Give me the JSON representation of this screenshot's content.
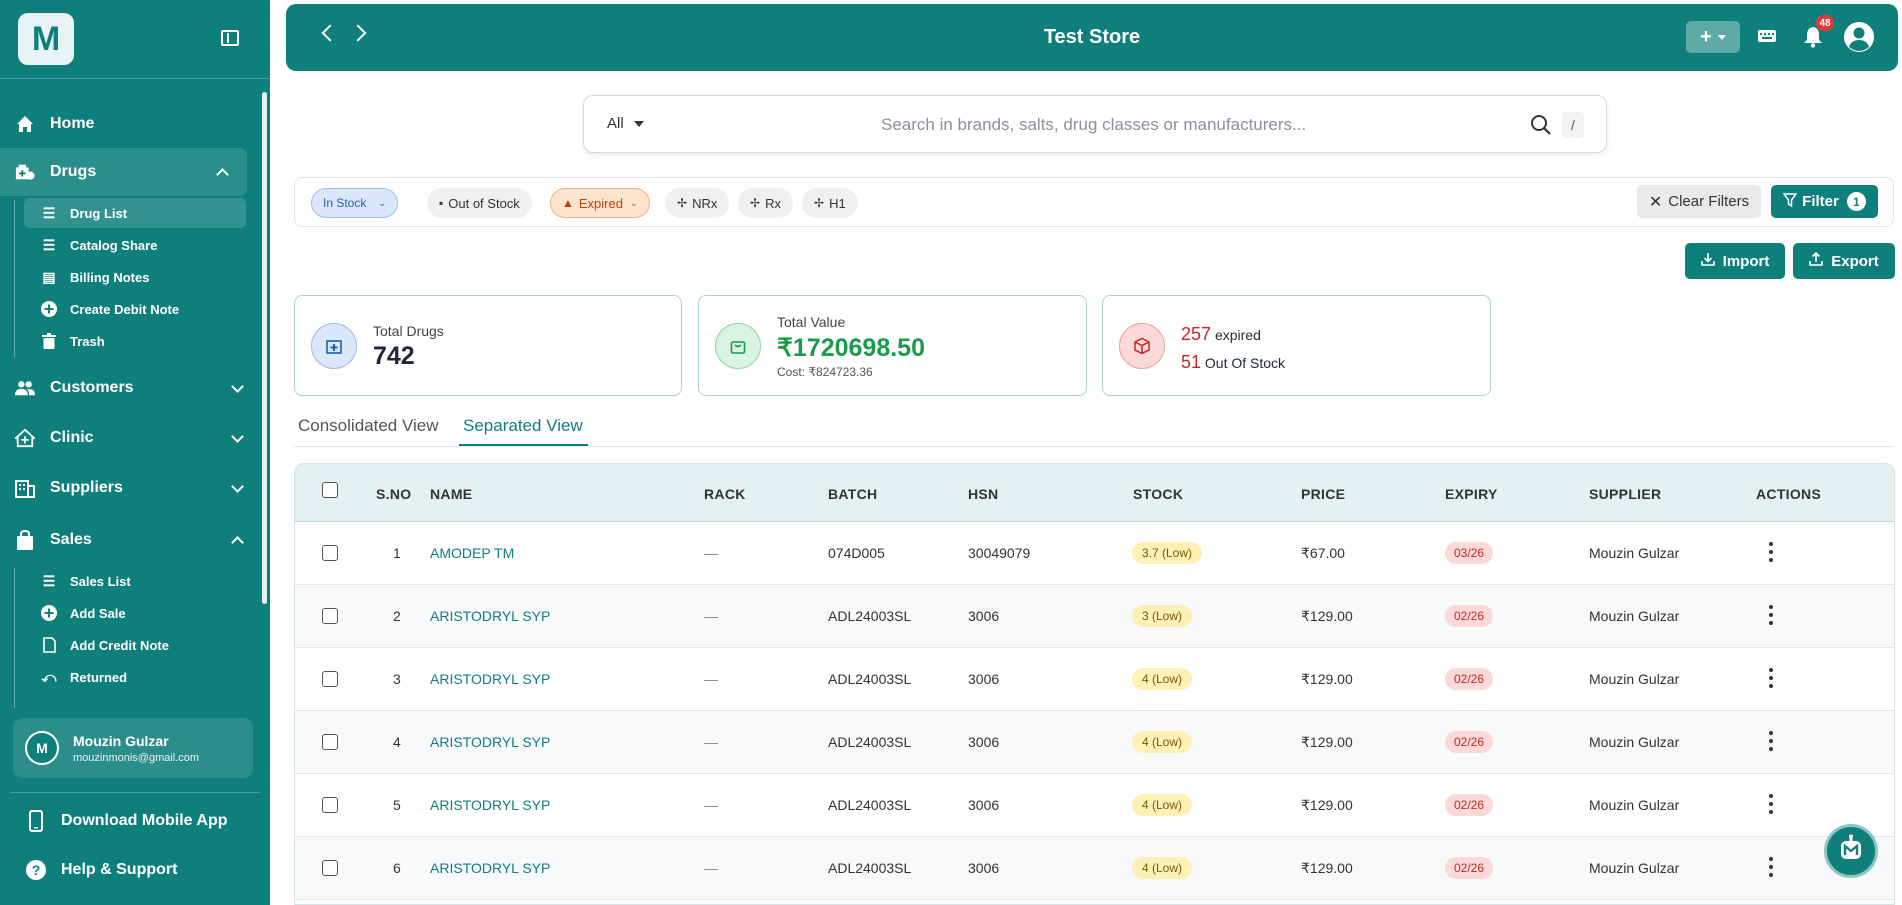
{
  "sidebar": {
    "logo": "M",
    "nav": [
      {
        "label": "Home"
      },
      {
        "label": "Drugs"
      },
      {
        "label": "Customers"
      },
      {
        "label": "Clinic"
      },
      {
        "label": "Suppliers"
      },
      {
        "label": "Sales"
      }
    ],
    "drugs_sub": [
      {
        "label": "Drug List"
      },
      {
        "label": "Catalog Share"
      },
      {
        "label": "Billing Notes"
      },
      {
        "label": "Create Debit Note"
      },
      {
        "label": "Trash"
      }
    ],
    "sales_sub": [
      {
        "label": "Sales List"
      },
      {
        "label": "Add Sale"
      },
      {
        "label": "Add Credit Note"
      },
      {
        "label": "Returned"
      }
    ],
    "user": {
      "initial": "M",
      "name": "Mouzin Gulzar",
      "email": "mouzinmonis@gmail.com"
    },
    "download_app": "Download Mobile App",
    "help": "Help & Support"
  },
  "header": {
    "title": "Test Store",
    "plus": "+",
    "notification_count": "48"
  },
  "search": {
    "scope": "All",
    "placeholder": "Search in brands, salts, drug classes or manufacturers...",
    "shortcut": "/"
  },
  "filters": {
    "chips": [
      "In Stock",
      "Out of Stock",
      "Expired",
      "NRx",
      "Rx",
      "H1"
    ],
    "clear_label": "Clear Filters",
    "filter_label": "Filter",
    "filter_count": "1"
  },
  "actions": {
    "import": "Import",
    "export": "Export"
  },
  "stats": {
    "total_drugs_label": "Total Drugs",
    "total_drugs": "742",
    "total_value_label": "Total Value",
    "total_value": "₹1720698.50",
    "cost": "Cost: ₹824723.36",
    "expired_count": "257",
    "expired_label": "expired",
    "oos_count": "51",
    "oos_label": "Out Of Stock"
  },
  "tabs": {
    "consolidated": "Consolidated View",
    "separated": "Separated View"
  },
  "table": {
    "headers": [
      "S.NO",
      "NAME",
      "RACK",
      "BATCH",
      "HSN",
      "STOCK",
      "PRICE",
      "EXPIRY",
      "SUPPLIER",
      "ACTIONS"
    ],
    "rows": [
      {
        "sno": "1",
        "name": "AMODEP TM",
        "rack": "—",
        "batch": "074D005",
        "hsn": "30049079",
        "stock": "3.7 (Low)",
        "price": "₹67.00",
        "expiry": "03/26",
        "supplier": "Mouzin Gulzar"
      },
      {
        "sno": "2",
        "name": "ARISTODRYL SYP",
        "rack": "—",
        "batch": "ADL24003SL",
        "hsn": "3006",
        "stock": "3 (Low)",
        "price": "₹129.00",
        "expiry": "02/26",
        "supplier": "Mouzin Gulzar"
      },
      {
        "sno": "3",
        "name": "ARISTODRYL SYP",
        "rack": "—",
        "batch": "ADL24003SL",
        "hsn": "3006",
        "stock": "4 (Low)",
        "price": "₹129.00",
        "expiry": "02/26",
        "supplier": "Mouzin Gulzar"
      },
      {
        "sno": "4",
        "name": "ARISTODRYL SYP",
        "rack": "—",
        "batch": "ADL24003SL",
        "hsn": "3006",
        "stock": "4 (Low)",
        "price": "₹129.00",
        "expiry": "02/26",
        "supplier": "Mouzin Gulzar"
      },
      {
        "sno": "5",
        "name": "ARISTODRYL SYP",
        "rack": "—",
        "batch": "ADL24003SL",
        "hsn": "3006",
        "stock": "4 (Low)",
        "price": "₹129.00",
        "expiry": "02/26",
        "supplier": "Mouzin Gulzar"
      },
      {
        "sno": "6",
        "name": "ARISTODRYL SYP",
        "rack": "—",
        "batch": "ADL24003SL",
        "hsn": "3006",
        "stock": "4 (Low)",
        "price": "₹129.00",
        "expiry": "02/26",
        "supplier": "Mouzin Gulzar"
      }
    ]
  },
  "colors": {
    "brand": "#0f7f7c",
    "danger": "#c62828",
    "success": "#1a9b4b"
  }
}
